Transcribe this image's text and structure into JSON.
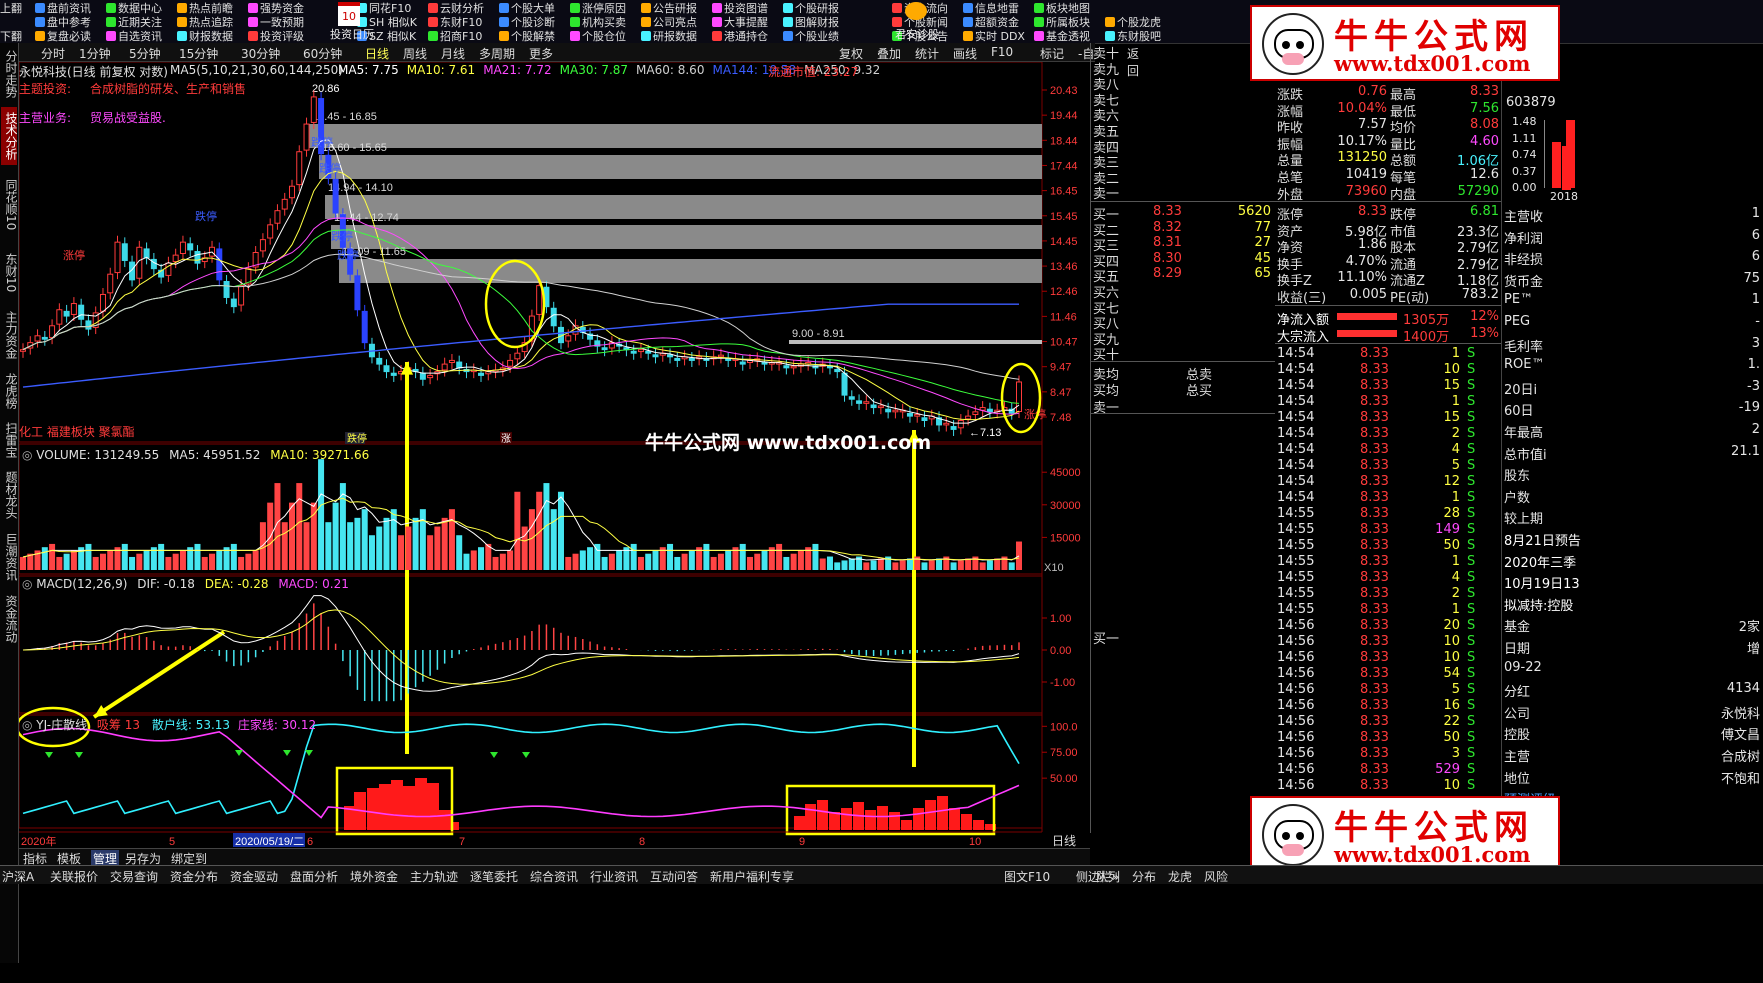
{
  "toolbar": {
    "row1": [
      "上翻",
      "盘前资讯",
      "数据中心",
      "热点前瞻",
      "强势资金",
      "同花F10",
      "云财分析",
      "个股大单",
      "涨停原因",
      "公告研报",
      "投资图谱",
      "个股研报",
      "资金流向",
      "信息地雷",
      "板块地图"
    ],
    "row2": [
      "盘中参考",
      "近期关注",
      "热点追踪",
      "一致预期",
      "SH 相似K",
      "东财F10",
      "个股诊断",
      "机构买卖",
      "公司亮点",
      "大事提醒",
      "图解财报",
      "个股新闻",
      "超额资金",
      "所属板块",
      "个股龙虎"
    ],
    "row3": [
      "下翻",
      "复盘必读",
      "自选资讯",
      "财报数据",
      "投资评级",
      "SZ 相似K",
      "招商F10",
      "个股解禁",
      "个股仓位",
      "研报数据",
      "港通持仓",
      "个股业绩",
      "个股公告",
      "实时 DDX",
      "基金透视",
      "东财股吧"
    ],
    "calendar_day": "10",
    "calendar_label": "投资日历",
    "junan_label": "君安诊股"
  },
  "side_tabs": [
    "分时走势",
    "技术分析",
    "同花顺10",
    "东财10",
    "主力资金",
    "龙虎榜",
    "扫雷宝",
    "题材龙头",
    "巨潮资讯",
    "资金流动"
  ],
  "period_bar": {
    "items": [
      "分时",
      "1分钟",
      "5分钟",
      "15分钟",
      "30分钟",
      "60分钟",
      "日线",
      "周线",
      "月线",
      "多周期",
      "更多"
    ],
    "active": "日线",
    "right_items": [
      "复权",
      "叠加",
      "统计",
      "画线",
      "F10",
      "标记",
      "-自选",
      "返回"
    ]
  },
  "main_chart": {
    "title": "永悦科技(日线 前复权 对数)",
    "ma_header": "MA5(5,10,21,30,60,144,250)",
    "ma_values": [
      {
        "label": "MA5: 7.75",
        "color": "#ffffff"
      },
      {
        "label": "MA10: 7.61",
        "color": "#ffff44"
      },
      {
        "label": "MA21: 7.72",
        "color": "#ff4aff"
      },
      {
        "label": "MA30: 7.87",
        "color": "#3cff3c"
      },
      {
        "label": "MA60: 8.60",
        "color": "#d0d0d0"
      },
      {
        "label": "MA144: 10.58",
        "color": "#3b5cff"
      },
      {
        "label": "MA250: 9.32",
        "color": "#d0d0d0"
      }
    ],
    "float_value": "流通市值: 23.27",
    "theme_label": "主题投资:",
    "theme_text": "合成树脂的研发、生产和销售",
    "business_label": "主营业务:",
    "business_text": "贸易战受益股.",
    "sector_text": "化工 福建板块 聚氯酯",
    "y_ticks": [
      "20.43",
      "19.44",
      "18.44",
      "17.44",
      "16.45",
      "15.45",
      "14.45",
      "13.46",
      "12.46",
      "11.46",
      "10.47",
      "9.47",
      "8.47",
      "7.48"
    ],
    "gaps": [
      {
        "label": "18.45 - 16.85"
      },
      {
        "label": "16.60 - 15.65"
      },
      {
        "label": "14.94 - 14.10"
      },
      {
        "label": "13.44 - 12.74"
      },
      {
        "label": "13.09 - 11.65"
      },
      {
        "label": "9.00 - 8.91"
      }
    ],
    "high_label": "20.86",
    "low_label": "7.13",
    "limit_down_label": "跌停",
    "limit_up_label": "涨停",
    "tag_labels": [
      "跌停",
      "涨"
    ],
    "watermark": "牛牛公式网 www.tdx001.com"
  },
  "volume_panel": {
    "header": "VOLUME: 131249.55",
    "ma5": "MA5: 45951.52",
    "ma10": "MA10: 39271.66",
    "y_ticks": [
      "45000",
      "30000",
      "15000"
    ],
    "unit": "X10"
  },
  "macd_panel": {
    "header": "MACD(12,26,9)",
    "dif": "DIF: -0.18",
    "dea": "DEA: -0.28",
    "macd": "MACD: 0.21",
    "y_ticks": [
      "1.00",
      "0.00",
      "-1.00"
    ]
  },
  "yj_panel": {
    "header": "YJ-庄散线",
    "warn": "吸筹",
    "warn_val": "13",
    "retail": "散户线: 53.13",
    "banker": "庄家线: 30.12",
    "y_ticks": [
      "100.0",
      "75.00",
      "50.00"
    ]
  },
  "x_axis": {
    "labels": [
      "2020年",
      "5",
      "2020/05/19/二",
      "6",
      "7",
      "8",
      "9",
      "10"
    ],
    "period": "日线"
  },
  "bottom_tabs": [
    "指标",
    "模板",
    "管理",
    "另存为",
    "绑定到"
  ],
  "order_book": {
    "sell_levels": [
      "卖十",
      "卖九",
      "卖八",
      "卖七",
      "卖六",
      "卖五",
      "卖四",
      "卖三",
      "卖二",
      "卖一"
    ],
    "buy_levels": [
      {
        "label": "买一",
        "price": "8.33",
        "vol": "5620"
      },
      {
        "label": "买二",
        "price": "8.32",
        "vol": "77"
      },
      {
        "label": "买三",
        "price": "8.31",
        "vol": "27"
      },
      {
        "label": "买四",
        "price": "8.30",
        "vol": "45"
      },
      {
        "label": "买五",
        "price": "8.29",
        "vol": "65"
      },
      {
        "label": "买六",
        "price": "",
        "vol": ""
      },
      {
        "label": "买七",
        "price": "",
        "vol": ""
      },
      {
        "label": "买八",
        "price": "",
        "vol": ""
      },
      {
        "label": "买九",
        "price": "",
        "vol": ""
      },
      {
        "label": "买十",
        "price": "",
        "vol": ""
      }
    ],
    "avg_rows": [
      {
        "label": "卖均",
        "right": "总卖"
      },
      {
        "label": "买均",
        "right": "总买"
      }
    ],
    "sell_one": "卖一",
    "buy_one_bottom": "买一"
  },
  "quote_stats": [
    {
      "l": "涨跌",
      "v": "0.76",
      "l2": "最高",
      "v2": "8.33",
      "c": "red",
      "c2": "red"
    },
    {
      "l": "涨幅",
      "v": "10.04%",
      "l2": "最低",
      "v2": "7.56",
      "c": "red",
      "c2": "green"
    },
    {
      "l": "昨收",
      "v": "7.57",
      "l2": "均价",
      "v2": "8.08",
      "c": "white",
      "c2": "red"
    },
    {
      "l": "振幅",
      "v": "10.17%",
      "l2": "量比",
      "v2": "4.60",
      "c": "white",
      "c2": "mag"
    },
    {
      "l": "总量",
      "v": "131250",
      "l2": "总额",
      "v2": "1.06亿",
      "c": "yellow",
      "c2": "cyan"
    },
    {
      "l": "总笔",
      "v": "10419",
      "l2": "每笔",
      "v2": "12.6",
      "c": "white",
      "c2": "white"
    },
    {
      "l": "外盘",
      "v": "73960",
      "l2": "内盘",
      "v2": "57290",
      "c": "red",
      "c2": "green"
    }
  ],
  "fundamentals": [
    {
      "l": "涨停",
      "v": "8.33",
      "l2": "跌停",
      "v2": "6.81",
      "c": "red",
      "c2": "green"
    },
    {
      "l": "资产",
      "v": "5.98亿",
      "l2": "市值",
      "v2": "23.3亿",
      "c": "white",
      "c2": "white"
    },
    {
      "l": "净资",
      "v": "1.86",
      "l2": "股本",
      "v2": "2.79亿",
      "c": "white",
      "c2": "white"
    },
    {
      "l": "换手",
      "v": "4.70%",
      "l2": "流通",
      "v2": "2.79亿",
      "c": "white",
      "c2": "white"
    },
    {
      "l": "换手Z",
      "v": "11.10%",
      "l2": "流通Z",
      "v2": "1.18亿",
      "c": "white",
      "c2": "white"
    },
    {
      "l": "收益(三)",
      "v": "0.005",
      "l2": "PE(动)",
      "v2": "783.2",
      "c": "white",
      "c2": "white"
    }
  ],
  "flows": [
    {
      "l": "净流入额",
      "v": "1305万",
      "p": "12%"
    },
    {
      "l": "大宗流入",
      "v": "1400万",
      "p": "13%"
    }
  ],
  "ticks": [
    {
      "t": "14:54",
      "p": "8.33",
      "v": "1",
      "s": "S"
    },
    {
      "t": "14:54",
      "p": "8.33",
      "v": "10",
      "s": "S"
    },
    {
      "t": "14:54",
      "p": "8.33",
      "v": "15",
      "s": "S"
    },
    {
      "t": "14:54",
      "p": "8.33",
      "v": "1",
      "s": "S"
    },
    {
      "t": "14:54",
      "p": "8.33",
      "v": "15",
      "s": "S"
    },
    {
      "t": "14:54",
      "p": "8.33",
      "v": "2",
      "s": "S"
    },
    {
      "t": "14:54",
      "p": "8.33",
      "v": "4",
      "s": "S"
    },
    {
      "t": "14:54",
      "p": "8.33",
      "v": "5",
      "s": "S"
    },
    {
      "t": "14:54",
      "p": "8.33",
      "v": "12",
      "s": "S"
    },
    {
      "t": "14:54",
      "p": "8.33",
      "v": "1",
      "s": "S"
    },
    {
      "t": "14:55",
      "p": "8.33",
      "v": "28",
      "s": "S"
    },
    {
      "t": "14:55",
      "p": "8.33",
      "v": "149",
      "s": "S"
    },
    {
      "t": "14:55",
      "p": "8.33",
      "v": "50",
      "s": "S"
    },
    {
      "t": "14:55",
      "p": "8.33",
      "v": "1",
      "s": "S"
    },
    {
      "t": "14:55",
      "p": "8.33",
      "v": "4",
      "s": "S"
    },
    {
      "t": "14:55",
      "p": "8.33",
      "v": "2",
      "s": "S"
    },
    {
      "t": "14:55",
      "p": "8.33",
      "v": "1",
      "s": "S"
    },
    {
      "t": "14:56",
      "p": "8.33",
      "v": "20",
      "s": "S"
    },
    {
      "t": "14:56",
      "p": "8.33",
      "v": "10",
      "s": "S"
    },
    {
      "t": "14:56",
      "p": "8.33",
      "v": "10",
      "s": "S"
    },
    {
      "t": "14:56",
      "p": "8.33",
      "v": "54",
      "s": "S"
    },
    {
      "t": "14:56",
      "p": "8.33",
      "v": "5",
      "s": "S"
    },
    {
      "t": "14:56",
      "p": "8.33",
      "v": "16",
      "s": "S"
    },
    {
      "t": "14:56",
      "p": "8.33",
      "v": "22",
      "s": "S"
    },
    {
      "t": "14:56",
      "p": "8.33",
      "v": "50",
      "s": "S"
    },
    {
      "t": "14:56",
      "p": "8.33",
      "v": "3",
      "s": "S"
    },
    {
      "t": "14:56",
      "p": "8.33",
      "v": "529",
      "s": "S"
    },
    {
      "t": "14:56",
      "p": "8.33",
      "v": "10",
      "s": "S"
    }
  ],
  "far_right": {
    "code": "603879",
    "mini_ticks": [
      "1.48",
      "1.11",
      "0.74",
      "0.37",
      "0.00"
    ],
    "mini_year": "2018",
    "rows": [
      "主营收",
      "净利润",
      "非经损",
      "货币金",
      "PE™",
      "PEG",
      "毛利率",
      "ROE™",
      "20日i",
      "60日",
      "年最高",
      "总市值i",
      "股东",
      "户数",
      "较上期",
      "8月21日预告",
      "2020年三季",
      "10月19日13",
      "拟减持:控股",
      "基金",
      "日期",
      "09-22",
      "分红",
      "公司",
      "控股",
      "主营",
      "地位",
      "预测评级"
    ],
    "row_values": [
      "1",
      "6",
      "6",
      "75",
      "1",
      "-",
      "3",
      "1.",
      "-3",
      "-19",
      "2",
      "21.1",
      "",
      "",
      "",
      "",
      "",
      "",
      "",
      "2家",
      "增",
      "",
      "4134",
      "永悦科",
      "傅文昌",
      "合成树",
      "不饱和",
      ""
    ]
  },
  "status_bar": [
    "沪深A",
    "关联报价",
    "交易查询",
    "资金分布",
    "资金驱动",
    "盘面分析",
    "境外资金",
    "主力轨迹",
    "逐笔委托",
    "综合资讯",
    "行业资讯",
    "互动问答",
    "新用户福利专享",
    "图文F10",
    "侧边栏»",
    "队列",
    "分布",
    "龙虎",
    "风险"
  ],
  "logo": {
    "title": "牛牛公式网",
    "url": "www.tdx001.com"
  }
}
